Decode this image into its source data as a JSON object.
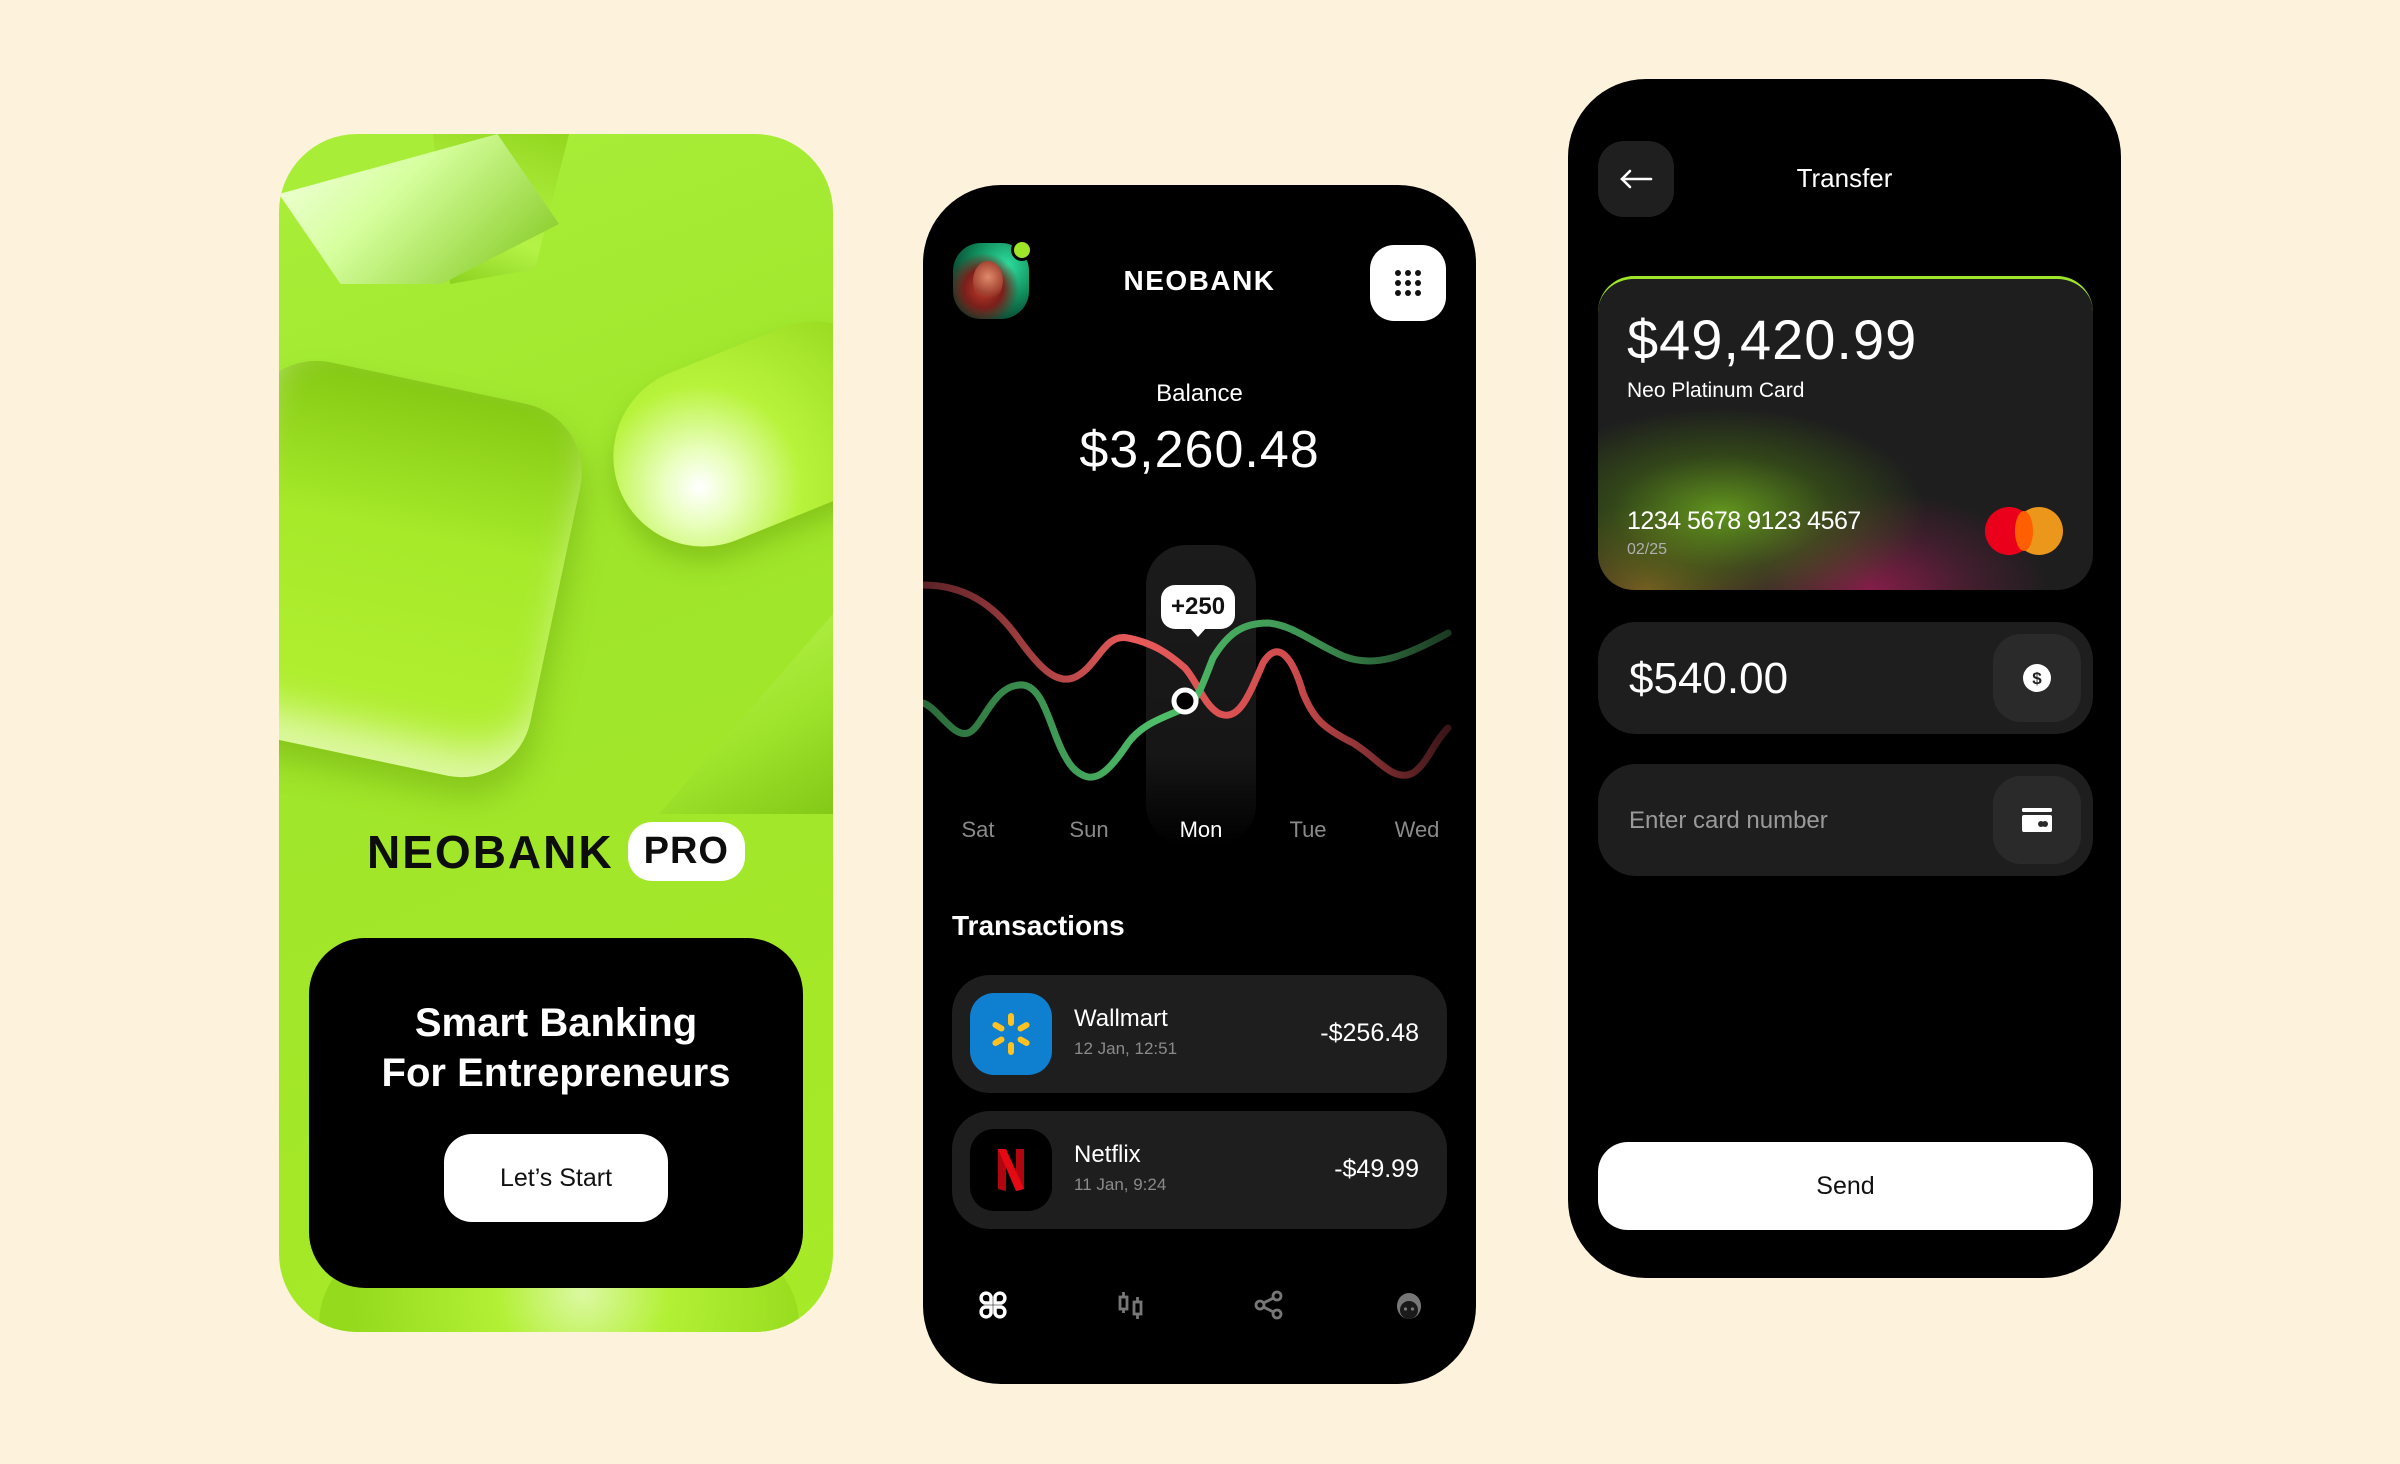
{
  "onboarding": {
    "brand": "NEOBANK",
    "badge": "PRO",
    "headline_line1": "Smart Banking",
    "headline_line2": "For Entrepreneurs",
    "cta_label": "Let’s Start",
    "accent_color": "#a3ea2a"
  },
  "dashboard": {
    "app_title": "NEOBANK",
    "menu_icon": "grid-dots-icon",
    "avatar_status": "online",
    "balance_label": "Balance",
    "balance_value": "$3,260.48",
    "chart": {
      "days": [
        "Sat",
        "Sun",
        "Mon",
        "Tue",
        "Wed"
      ],
      "selected_day": "Mon",
      "tooltip": "+250",
      "income_color": "#4fbf6a",
      "expense_color": "#e85a5a"
    },
    "transactions_title": "Transactions",
    "transactions": [
      {
        "merchant": "Wallmart",
        "datetime": "12 Jan, 12:51",
        "amount": "-$256.48",
        "logo": "walmart-spark-icon"
      },
      {
        "merchant": "Netflix",
        "datetime": "11 Jan, 9:24",
        "amount": "-$49.99",
        "logo": "netflix-n-icon"
      }
    ],
    "nav": [
      {
        "icon": "dashboard-icon",
        "active": true
      },
      {
        "icon": "candlestick-chart-icon",
        "active": false
      },
      {
        "icon": "share-icon",
        "active": false
      },
      {
        "icon": "profile-icon",
        "active": false
      }
    ]
  },
  "transfer": {
    "title": "Transfer",
    "card": {
      "balance": "$49,420.99",
      "name": "Neo Platinum Card",
      "number": "1234 5678 9123 4567",
      "expiry": "02/25",
      "network": "mastercard"
    },
    "amount_value": "$540.00",
    "card_number_placeholder": "Enter card number",
    "send_label": "Send"
  }
}
